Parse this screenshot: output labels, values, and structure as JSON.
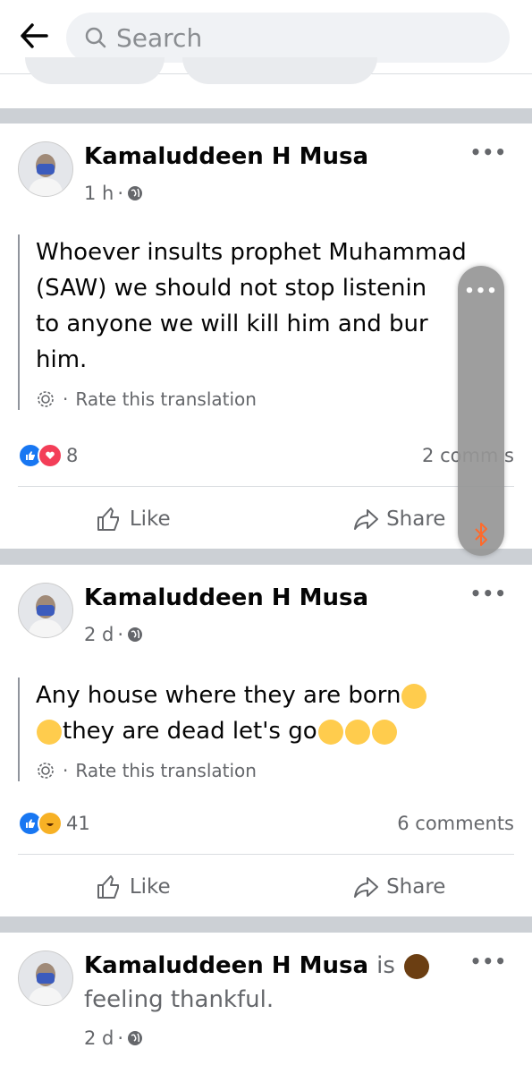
{
  "search": {
    "placeholder": "Search"
  },
  "posts": [
    {
      "author": "Kamaluddeen H Musa",
      "time": "1 h",
      "text": "Whoever insults prophet Muhammad (SAW) we should not stop listening to anyone we will kill him and burn him.",
      "text_lines": [
        "Whoever insults prophet Muhammad",
        "(SAW) we should not stop listenin",
        "to anyone we will kill him and bur",
        "him."
      ],
      "rate_label": "Rate this translation",
      "reactions": [
        "like",
        "love"
      ],
      "reaction_count": "8",
      "comments": "2 comm   s",
      "like_label": "Like",
      "share_label": "Share"
    },
    {
      "author": "Kamaluddeen H Musa",
      "time": "2 d",
      "text_lines": [
        "Any house where they are born",
        "they are dead let's go"
      ],
      "rate_label": "Rate this translation",
      "reactions": [
        "like",
        "haha"
      ],
      "reaction_count": "41",
      "comments": "6 comments",
      "like_label": "Like",
      "share_label": "Share"
    },
    {
      "author": "Kamaluddeen H Musa",
      "feeling_prefix": "is",
      "feeling_text": "feeling thankful.",
      "time": "2 d"
    }
  ],
  "colors": {
    "like_blue": "#1877f2",
    "love_red": "#f33e58",
    "haha_yellow": "#f7b125",
    "separator": "#ccd0d5"
  },
  "icons": [
    "back-arrow-icon",
    "search-icon",
    "globe-icon",
    "gear-icon",
    "thumbs-up-icon",
    "share-arrow-icon",
    "bluetooth-icon"
  ]
}
